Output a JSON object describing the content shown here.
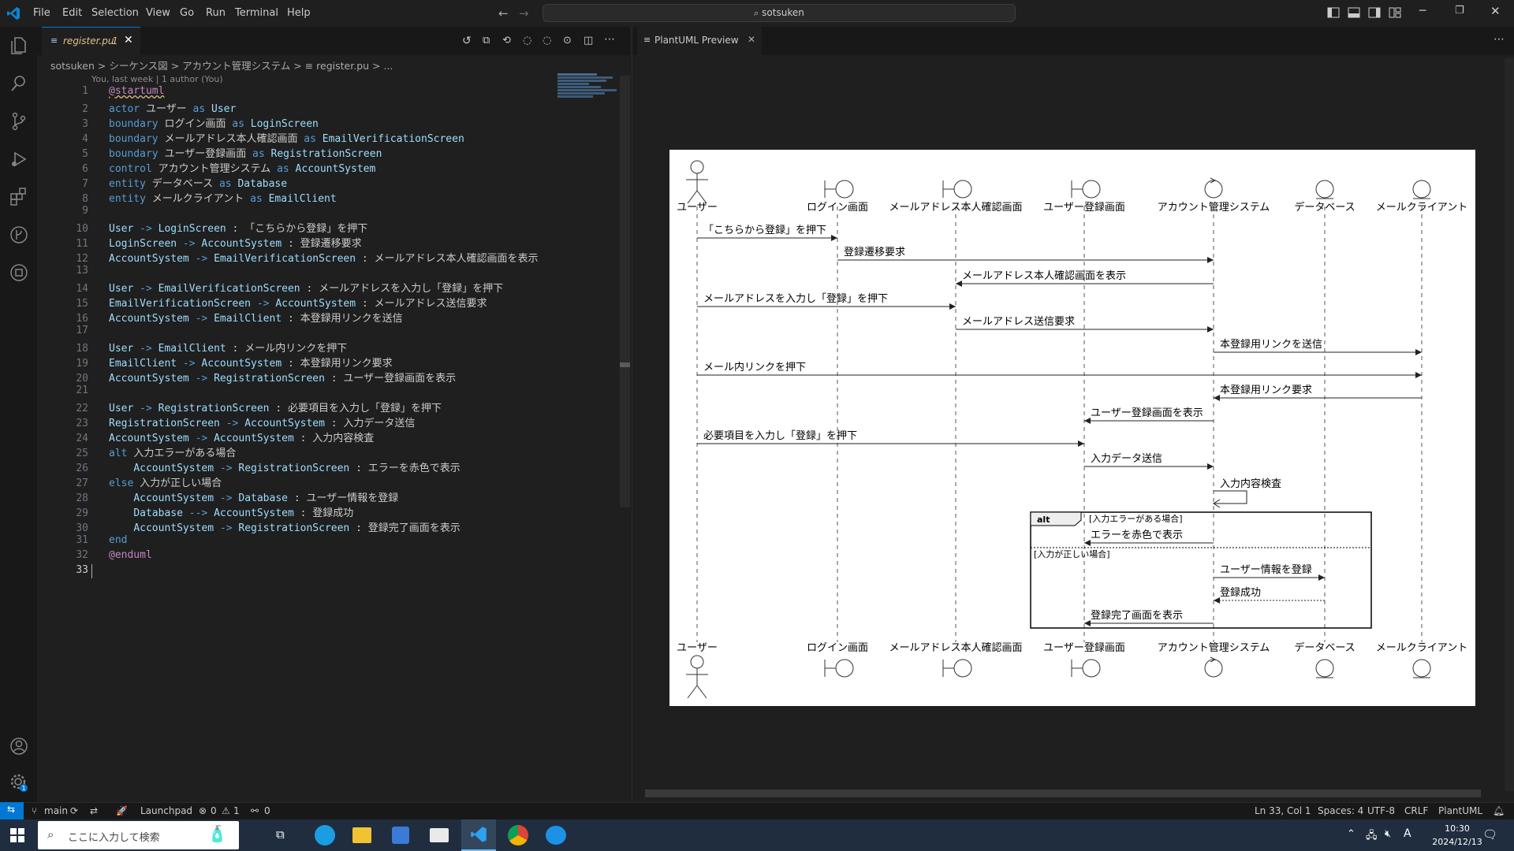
{
  "titlebar": {
    "menu": [
      "File",
      "Edit",
      "Selection",
      "View",
      "Go",
      "Run",
      "Terminal",
      "Help"
    ],
    "search_text": "sotsuken",
    "search_icon": "search-icon"
  },
  "editor": {
    "tab_label": "register.pu",
    "tab_badge": "1",
    "breadcrumb": [
      "sotsuken",
      "シーケンス図",
      "アカウント管理システム",
      "register.pu",
      "..."
    ],
    "blame": "You, last week | 1 author (You)",
    "lines": [
      {
        "n": "1",
        "parts": [
          [
            "ctl",
            "@startuml"
          ]
        ]
      },
      {
        "n": "2",
        "parts": [
          [
            "kw",
            "actor "
          ],
          [
            "tx",
            "ユーザー "
          ],
          [
            "kw",
            "as "
          ],
          [
            "id",
            "User"
          ]
        ]
      },
      {
        "n": "3",
        "parts": [
          [
            "kw",
            "boundary "
          ],
          [
            "tx",
            "ログイン画面 "
          ],
          [
            "kw",
            "as "
          ],
          [
            "id",
            "LoginScreen"
          ]
        ]
      },
      {
        "n": "4",
        "parts": [
          [
            "kw",
            "boundary "
          ],
          [
            "tx",
            "メールアドレス本人確認画面 "
          ],
          [
            "kw",
            "as "
          ],
          [
            "id",
            "EmailVerificationScreen"
          ]
        ]
      },
      {
        "n": "5",
        "parts": [
          [
            "kw",
            "boundary "
          ],
          [
            "tx",
            "ユーザー登録画面 "
          ],
          [
            "kw",
            "as "
          ],
          [
            "id",
            "RegistrationScreen"
          ]
        ]
      },
      {
        "n": "6",
        "parts": [
          [
            "kw",
            "control "
          ],
          [
            "tx",
            "アカウント管理システム "
          ],
          [
            "kw",
            "as "
          ],
          [
            "id",
            "AccountSystem"
          ]
        ]
      },
      {
        "n": "7",
        "parts": [
          [
            "kw",
            "entity "
          ],
          [
            "tx",
            "データベース "
          ],
          [
            "kw",
            "as "
          ],
          [
            "id",
            "Database"
          ]
        ]
      },
      {
        "n": "8",
        "parts": [
          [
            "kw",
            "entity "
          ],
          [
            "tx",
            "メールクライアント "
          ],
          [
            "kw",
            "as "
          ],
          [
            "id",
            "EmailClient"
          ]
        ]
      },
      {
        "n": "9",
        "parts": []
      },
      {
        "n": "10",
        "parts": [
          [
            "id",
            "User "
          ],
          [
            "kw",
            "-> "
          ],
          [
            "id",
            "LoginScreen "
          ],
          [
            "tx",
            ": 「こちらから登録」を押下"
          ]
        ]
      },
      {
        "n": "11",
        "parts": [
          [
            "id",
            "LoginScreen "
          ],
          [
            "kw",
            "-> "
          ],
          [
            "id",
            "AccountSystem "
          ],
          [
            "tx",
            ": 登録遷移要求"
          ]
        ]
      },
      {
        "n": "12",
        "parts": [
          [
            "id",
            "AccountSystem "
          ],
          [
            "kw",
            "-> "
          ],
          [
            "id",
            "EmailVerificationScreen "
          ],
          [
            "tx",
            ": メールアドレス本人確認画面を表示"
          ]
        ]
      },
      {
        "n": "13",
        "parts": []
      },
      {
        "n": "14",
        "parts": [
          [
            "id",
            "User "
          ],
          [
            "kw",
            "-> "
          ],
          [
            "id",
            "EmailVerificationScreen "
          ],
          [
            "tx",
            ": メールアドレスを入力し「登録」を押下"
          ]
        ]
      },
      {
        "n": "15",
        "parts": [
          [
            "id",
            "EmailVerificationScreen "
          ],
          [
            "kw",
            "-> "
          ],
          [
            "id",
            "AccountSystem "
          ],
          [
            "tx",
            ": メールアドレス送信要求"
          ]
        ]
      },
      {
        "n": "16",
        "parts": [
          [
            "id",
            "AccountSystem "
          ],
          [
            "kw",
            "-> "
          ],
          [
            "id",
            "EmailClient "
          ],
          [
            "tx",
            ": 本登録用リンクを送信"
          ]
        ]
      },
      {
        "n": "17",
        "parts": []
      },
      {
        "n": "18",
        "parts": [
          [
            "id",
            "User "
          ],
          [
            "kw",
            "-> "
          ],
          [
            "id",
            "EmailClient "
          ],
          [
            "tx",
            ": メール内リンクを押下"
          ]
        ]
      },
      {
        "n": "19",
        "parts": [
          [
            "id",
            "EmailClient "
          ],
          [
            "kw",
            "-> "
          ],
          [
            "id",
            "AccountSystem "
          ],
          [
            "tx",
            ": 本登録用リンク要求"
          ]
        ]
      },
      {
        "n": "20",
        "parts": [
          [
            "id",
            "AccountSystem "
          ],
          [
            "kw",
            "-> "
          ],
          [
            "id",
            "RegistrationScreen "
          ],
          [
            "tx",
            ": ユーザー登録画面を表示"
          ]
        ]
      },
      {
        "n": "21",
        "parts": []
      },
      {
        "n": "22",
        "parts": [
          [
            "id",
            "User "
          ],
          [
            "kw",
            "-> "
          ],
          [
            "id",
            "RegistrationScreen "
          ],
          [
            "tx",
            ": 必要項目を入力し「登録」を押下"
          ]
        ]
      },
      {
        "n": "23",
        "parts": [
          [
            "id",
            "RegistrationScreen "
          ],
          [
            "kw",
            "-> "
          ],
          [
            "id",
            "AccountSystem "
          ],
          [
            "tx",
            ": 入力データ送信"
          ]
        ]
      },
      {
        "n": "24",
        "parts": [
          [
            "id",
            "AccountSystem "
          ],
          [
            "kw",
            "-> "
          ],
          [
            "id",
            "AccountSystem "
          ],
          [
            "tx",
            ": 入力内容検査"
          ]
        ]
      },
      {
        "n": "25",
        "parts": [
          [
            "kw",
            "alt "
          ],
          [
            "tx",
            "入力エラーがある場合"
          ]
        ]
      },
      {
        "n": "26",
        "parts": [
          [
            "tx",
            "    "
          ],
          [
            "id",
            "AccountSystem "
          ],
          [
            "kw",
            "-> "
          ],
          [
            "id",
            "RegistrationScreen "
          ],
          [
            "tx",
            ": エラーを赤色で表示"
          ]
        ]
      },
      {
        "n": "27",
        "parts": [
          [
            "kw",
            "else "
          ],
          [
            "tx",
            "入力が正しい場合"
          ]
        ]
      },
      {
        "n": "28",
        "parts": [
          [
            "tx",
            "    "
          ],
          [
            "id",
            "AccountSystem "
          ],
          [
            "kw",
            "-> "
          ],
          [
            "id",
            "Database "
          ],
          [
            "tx",
            ": ユーザー情報を登録"
          ]
        ]
      },
      {
        "n": "29",
        "parts": [
          [
            "tx",
            "    "
          ],
          [
            "id",
            "Database "
          ],
          [
            "kw",
            "--> "
          ],
          [
            "id",
            "AccountSystem "
          ],
          [
            "tx",
            ": 登録成功"
          ]
        ]
      },
      {
        "n": "30",
        "parts": [
          [
            "tx",
            "    "
          ],
          [
            "id",
            "AccountSystem "
          ],
          [
            "kw",
            "-> "
          ],
          [
            "id",
            "RegistrationScreen "
          ],
          [
            "tx",
            ": 登録完了画面を表示"
          ]
        ]
      },
      {
        "n": "31",
        "parts": [
          [
            "kw",
            "end"
          ]
        ]
      },
      {
        "n": "32",
        "parts": [
          [
            "ctl",
            "@enduml"
          ]
        ]
      },
      {
        "n": "33",
        "parts": []
      }
    ]
  },
  "preview": {
    "tab_label": "PlantUML Preview",
    "participants": [
      "ユーザー",
      "ログイン画面",
      "メールアドレス本人確認画面",
      "ユーザー登録画面",
      "アカウント管理システム",
      "データベース",
      "メールクライアント"
    ],
    "messages": [
      "「こちらから登録」を押下",
      "登録遷移要求",
      "メールアドレス本人確認画面を表示",
      "メールアドレスを入力し「登録」を押下",
      "メールアドレス送信要求",
      "本登録用リンクを送信",
      "メール内リンクを押下",
      "本登録用リンク要求",
      "ユーザー登録画面を表示",
      "必要項目を入力し「登録」を押下",
      "入力データ送信",
      "入力内容検査",
      "エラーを赤色で表示",
      "ユーザー情報を登録",
      "登録成功",
      "登録完了画面を表示"
    ],
    "alt_label": "alt",
    "alt_cond1": "[入力エラーがある場合]",
    "alt_cond2": "[入力が正しい場合]"
  },
  "statusbar": {
    "branch": "main",
    "launchpad": "Launchpad",
    "errors": "0",
    "warnings": "1",
    "ports": "0",
    "position": "Ln 33, Col 1",
    "spaces": "Spaces: 4",
    "encoding": "UTF-8",
    "eol": "CRLF",
    "language": "PlantUML"
  },
  "taskbar": {
    "search_placeholder": "ここに入力して検索",
    "time": "10:30",
    "date": "2024/12/13",
    "ime": "A"
  },
  "colors": {
    "accent": "#0078d4",
    "keyword": "#569cd6",
    "identifier": "#9cdcfe",
    "control": "#c586c0"
  }
}
